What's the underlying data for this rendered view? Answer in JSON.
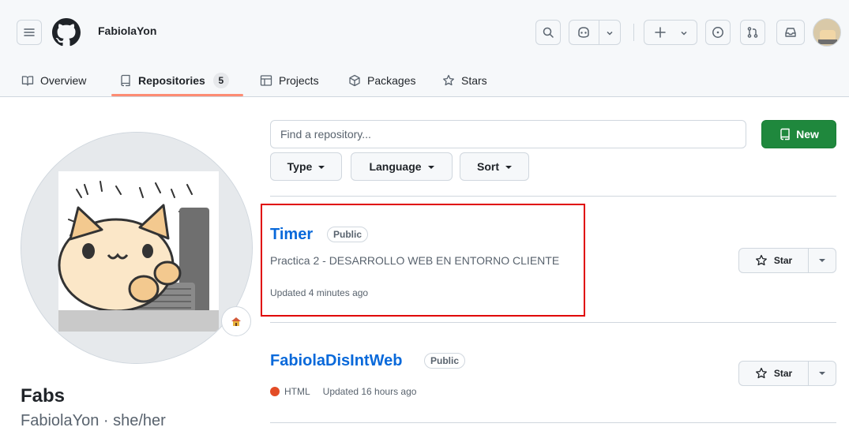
{
  "header": {
    "owner": "FabiolaYon"
  },
  "tabs": [
    {
      "label": "Overview"
    },
    {
      "label": "Repositories",
      "count": "5"
    },
    {
      "label": "Projects"
    },
    {
      "label": "Packages"
    },
    {
      "label": "Stars"
    }
  ],
  "profile": {
    "name": "Fabs",
    "subtitle": "FabiolaYon · she/her",
    "status_emoji": "house-icon"
  },
  "repo_toolbar": {
    "search_placeholder": "Find a repository...",
    "new_label": "New",
    "filters": [
      "Type",
      "Language",
      "Sort"
    ]
  },
  "repos": [
    {
      "name": "Timer",
      "visibility": "Public",
      "description": "Practica 2 - DESARROLLO WEB EN ENTORNO CLIENTE",
      "updated": "Updated 4 minutes ago",
      "star_label": "Star"
    },
    {
      "name": "FabiolaDisIntWeb",
      "visibility": "Public",
      "language": "HTML",
      "language_color": "#e34c26",
      "updated": "Updated 16 hours ago",
      "star_label": "Star"
    }
  ],
  "colors": {
    "accent": "#0969da",
    "primary_button": "#1f883d",
    "tab_underline": "#fd8c73",
    "highlight": "#e00000"
  }
}
